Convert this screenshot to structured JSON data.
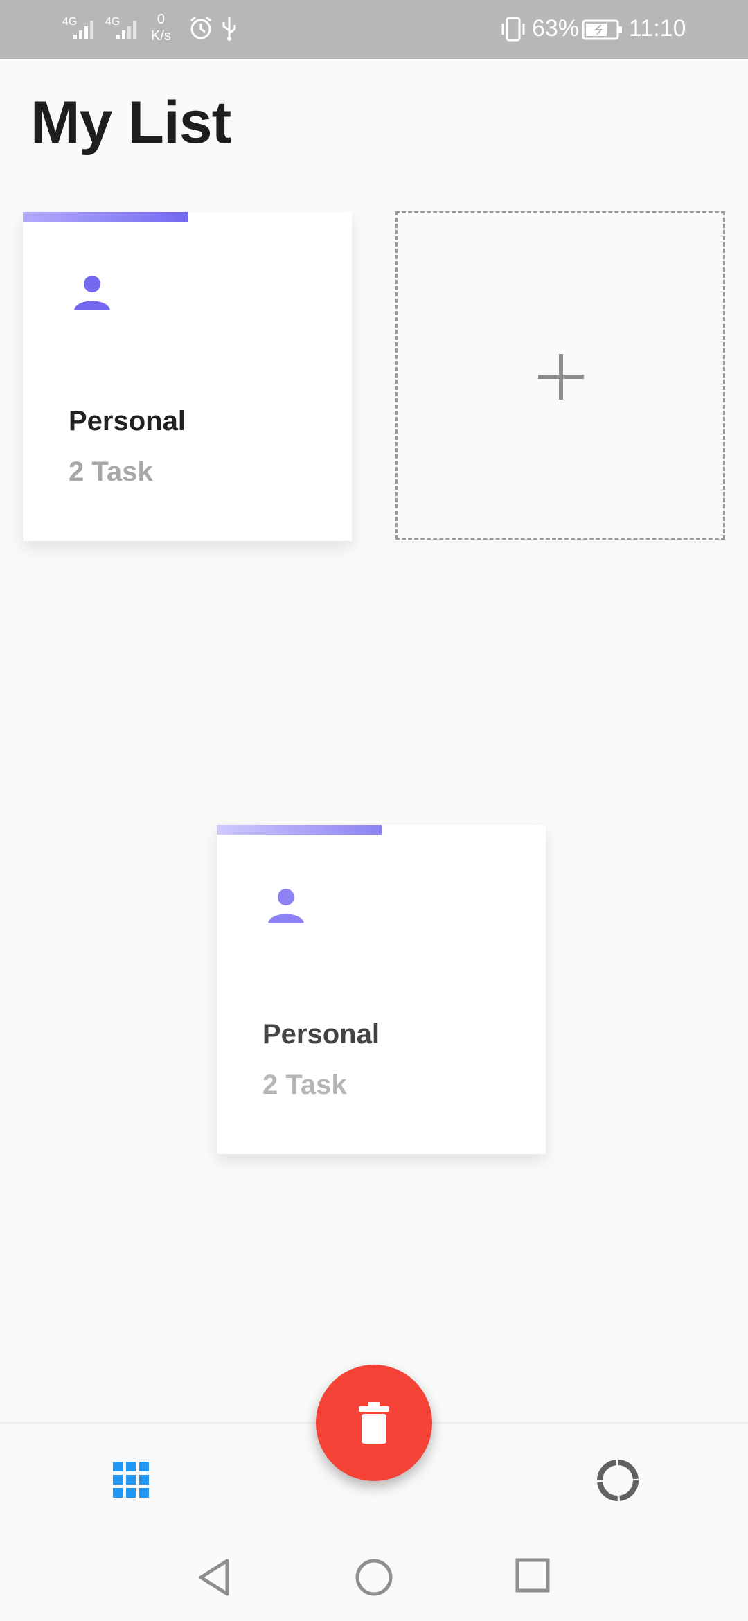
{
  "status_bar": {
    "network_1": "4G",
    "network_2": "4G",
    "speed_value": "0",
    "speed_unit": "K/s",
    "battery": "63%",
    "time": "11:10"
  },
  "page": {
    "title": "My List"
  },
  "lists": [
    {
      "title": "Personal",
      "count": "2 Task",
      "icon": "person-icon",
      "accent": "#7468f0"
    },
    {
      "title": "Personal",
      "count": "2 Task",
      "icon": "person-icon",
      "accent": "#8c82f2"
    }
  ],
  "add_tile": {
    "icon": "plus-icon"
  },
  "fab": {
    "icon": "trash-icon",
    "color": "#f44336"
  },
  "bottom_bar": {
    "left_icon": "grid-icon",
    "right_icon": "progress-icon",
    "left_color": "#2196f3"
  },
  "nav_bar": {
    "icons": [
      "back-icon",
      "home-icon",
      "recents-icon"
    ]
  }
}
